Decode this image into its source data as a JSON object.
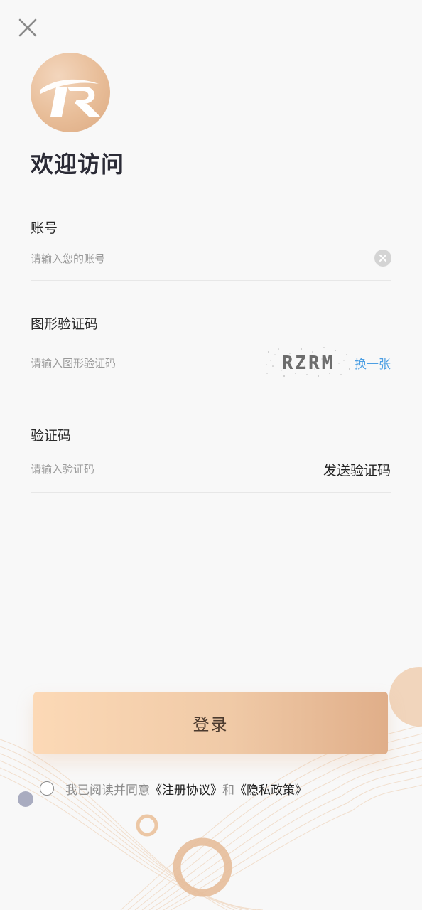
{
  "welcome_title": "欢迎访问",
  "account": {
    "label": "账号",
    "placeholder": "请输入您的账号",
    "value": ""
  },
  "captcha": {
    "label": "图形验证码",
    "placeholder": "请输入图形验证码",
    "value": "",
    "image_text": "RZRM",
    "refresh_label": "换一张"
  },
  "sms_code": {
    "label": "验证码",
    "placeholder": "请输入验证码",
    "value": "",
    "send_label": "发送验证码"
  },
  "login_button": {
    "label": "登录"
  },
  "agreement": {
    "checked": false,
    "prefix": "我已阅读并同意",
    "terms_link": "《注册协议》",
    "and": "和",
    "privacy_link": "《隐私政策》"
  },
  "icons": {
    "close": "close-icon",
    "clear": "clear-icon",
    "logo": "r-logo"
  },
  "colors": {
    "accent": "#e8bd98",
    "link_blue": "#4d9fe3",
    "background": "#f8f8f8"
  }
}
